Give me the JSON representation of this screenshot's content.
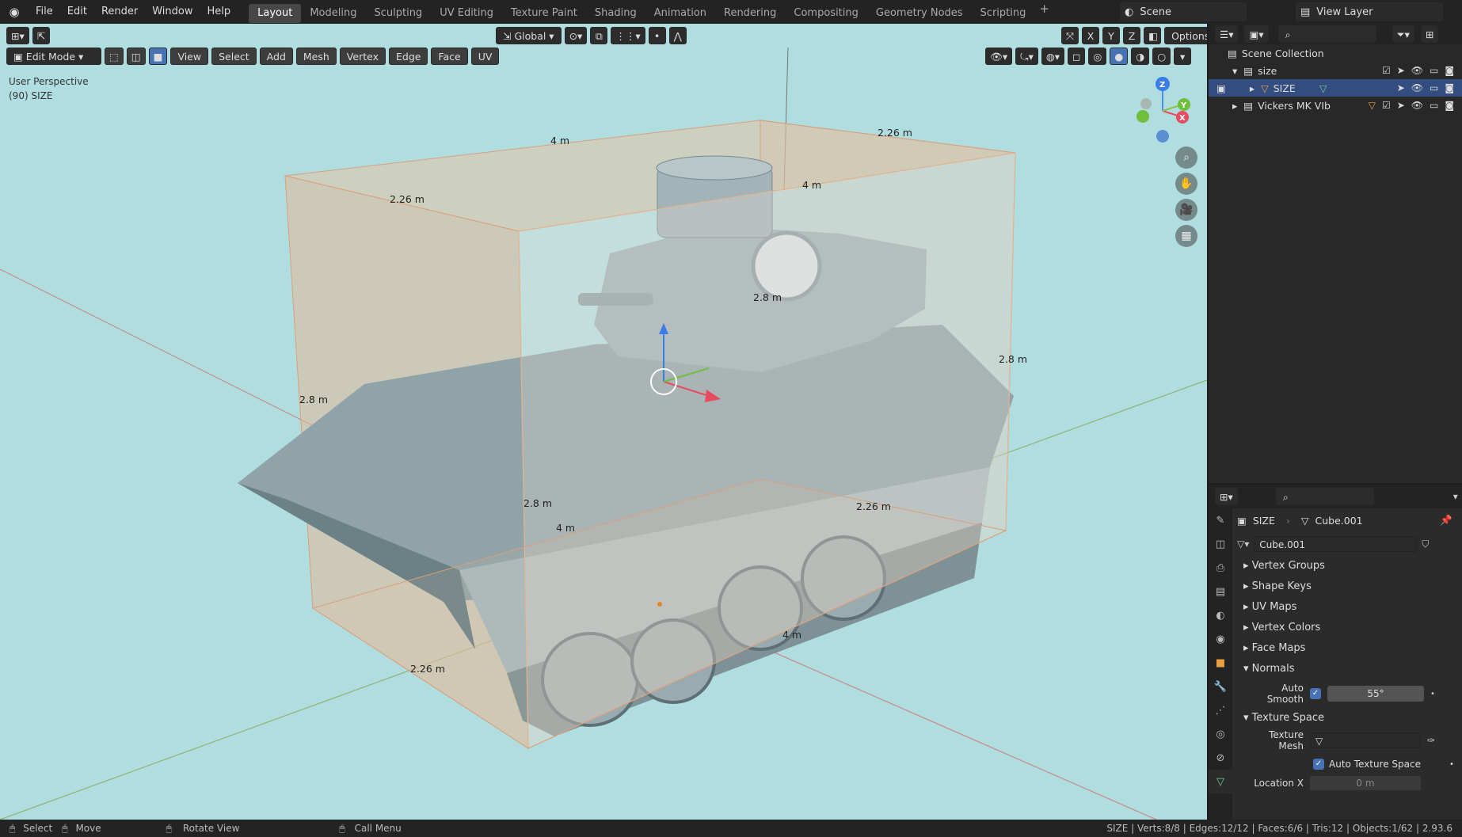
{
  "app": {
    "logo": "blender-logo"
  },
  "menu": [
    "File",
    "Edit",
    "Render",
    "Window",
    "Help"
  ],
  "workspaces": [
    "Layout",
    "Modeling",
    "Sculpting",
    "UV Editing",
    "Texture Paint",
    "Shading",
    "Animation",
    "Rendering",
    "Compositing",
    "Geometry Nodes",
    "Scripting"
  ],
  "active_workspace": "Layout",
  "scene_name": "Scene",
  "view_layer": "View Layer",
  "viewport": {
    "transform_orientation": "Global",
    "options_label": "Options",
    "mode": "Edit Mode",
    "menus": [
      "View",
      "Select",
      "Add",
      "Mesh",
      "Vertex",
      "Edge",
      "Face",
      "UV"
    ],
    "perspective_label": "User Perspective",
    "object_label": "(90) SIZE",
    "axis_buttons": [
      "X",
      "Y",
      "Z"
    ],
    "measurements": [
      "4 m",
      "2.26 m",
      "2.26 m",
      "4 m",
      "2.8 m",
      "2.8 m",
      "2.8 m",
      "2.8 m",
      "4 m",
      "2.26 m",
      "4 m",
      "2.26 m"
    ],
    "gizmo_axes": [
      "Z",
      "Y",
      "X"
    ]
  },
  "outliner": {
    "root": "Scene Collection",
    "items": [
      {
        "name": "size",
        "indent": 1
      },
      {
        "name": "SIZE",
        "indent": 2,
        "selected": true
      },
      {
        "name": "Vickers MK VIb",
        "indent": 1
      }
    ]
  },
  "properties": {
    "object_name": "SIZE",
    "mesh_name": "Cube.001",
    "datablock": "Cube.001",
    "panels": [
      "Vertex Groups",
      "Shape Keys",
      "UV Maps",
      "Vertex Colors",
      "Face Maps"
    ],
    "normals_label": "Normals",
    "auto_smooth_label": "Auto Smooth",
    "auto_smooth_angle": "55°",
    "texture_space_label": "Texture Space",
    "texture_mesh_label": "Texture Mesh",
    "auto_texture_space_label": "Auto Texture Space",
    "location_x_label": "Location X",
    "location_x_value": "0 m"
  },
  "statusbar": {
    "select": "Select",
    "move": "Move",
    "rotate": "Rotate View",
    "call_menu": "Call Menu",
    "stats": "SIZE | Verts:8/8 | Edges:12/12 | Faces:6/6 | Tris:12 | Objects:1/62 | 2.93.6"
  },
  "colors": {
    "accent": "#4772b3",
    "viewport_bg": "#b0dde0",
    "bbox": "#e8b08a",
    "x_axis": "#e84a5f",
    "y_axis": "#8bc34a",
    "z_axis": "#4a8fe8"
  }
}
